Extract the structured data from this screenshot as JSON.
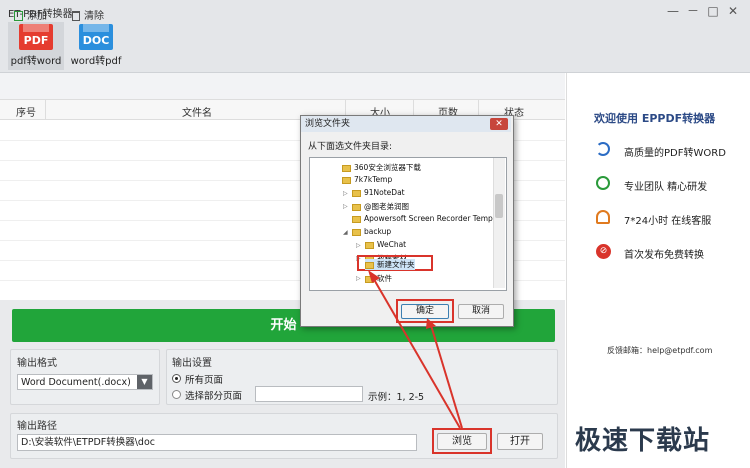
{
  "app": {
    "title": "ET-PDF转换器",
    "controls": [
      "—",
      "－",
      "□",
      "✕"
    ]
  },
  "modes": [
    {
      "badge": "PDF",
      "label": "pdf转word",
      "color": "#e53c2f"
    },
    {
      "badge": "DOC",
      "label": "word转pdf",
      "color": "#2b8fdd"
    }
  ],
  "toolbar": {
    "add_label": "添加",
    "clear_label": "清除"
  },
  "table": {
    "columns": [
      "序号",
      "文件名",
      "大小",
      "页数",
      "状态"
    ]
  },
  "start": {
    "label": "开始"
  },
  "output_format": {
    "label": "输出格式",
    "value": "Word Document(.docx)"
  },
  "output_settings": {
    "label": "输出设置",
    "all_pages": "所有页面",
    "partial_pages": "选择部分页面",
    "example": "示例：1, 2-5"
  },
  "output_path": {
    "label": "输出路径",
    "value": "D:\\安装软件\\ETPDF转换器\\doc",
    "browse_label": "浏览",
    "open_label": "打开"
  },
  "right_panel": {
    "welcome": "欢迎使用 EPPDF转换器",
    "features": [
      {
        "icon": "convert-icon",
        "text": "高质量的PDF转WORD"
      },
      {
        "icon": "atom-icon",
        "text": "专业团队 精心研发"
      },
      {
        "icon": "headset-icon",
        "text": "7*24小时 在线客服"
      },
      {
        "icon": "no-fee-icon",
        "text": "首次发布免费转换"
      }
    ],
    "feedback_label": "反馈邮箱：",
    "feedback_email": "help@etpdf.com"
  },
  "dialog": {
    "title": "浏览文件夹",
    "prompt": "从下面选文件夹目录:",
    "tree": [
      {
        "label": "360安全浏览器下载",
        "level": 1,
        "expandable": false
      },
      {
        "label": "7k7kTemp",
        "level": 1,
        "expandable": false
      },
      {
        "label": "91NoteDat",
        "level": 1,
        "expandable": true
      },
      {
        "label": "@图老弟润图",
        "level": 1,
        "expandable": true
      },
      {
        "label": "Apowersoft Screen Recorder Temp",
        "level": 1,
        "expandable": false
      },
      {
        "label": "backup",
        "level": 1,
        "expandable": true,
        "expanded": true
      },
      {
        "label": "WeChat",
        "level": 2,
        "expandable": true
      },
      {
        "label": "教程素材",
        "level": 2,
        "expandable": true
      },
      {
        "label": "新建文件夹",
        "level": 2,
        "expandable": false,
        "selected": true
      },
      {
        "label": "软件",
        "level": 2,
        "expandable": true
      }
    ],
    "ok_label": "确定",
    "cancel_label": "取消"
  },
  "accent_colors": {
    "start_green": "#21a53a",
    "highlight_red": "#d9342b",
    "pdf_red": "#e53c2f",
    "doc_blue": "#2b8fdd"
  },
  "watermark": "极速下载站"
}
